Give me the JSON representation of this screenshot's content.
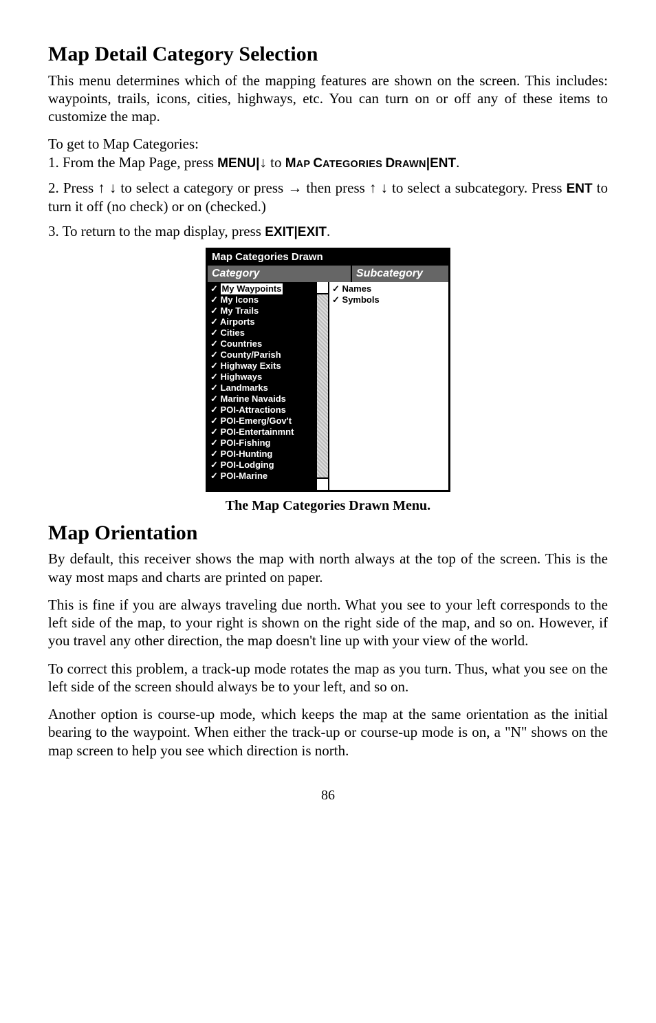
{
  "section1": {
    "heading": "Map Detail Category Selection",
    "p1": "This menu determines which of the mapping features are shown on the screen. This includes: waypoints, trails, icons, cities, highways, etc. You can turn on or off any of these items to customize the map.",
    "p2": "To get to Map Categories:",
    "step1_a": "1. From the Map Page, press ",
    "key_menu": "MENU",
    "step1_b": " to ",
    "smallcaps_m": "M",
    "smallcaps_ap": "AP ",
    "smallcaps_c": "C",
    "smallcaps_ategories": "ATEGORIES ",
    "smallcaps_d": "D",
    "smallcaps_rawn": "RAWN",
    "key_ent": "ENT",
    "step2_a": "2. Press ",
    "step2_b": " to select a category or press ",
    "step2_c": " then press ",
    "step2_d": " to select a subcategory. Press ",
    "step2_e": " to turn it off (no check) or on (checked.)",
    "step3_a": "3. To return to the map display, press ",
    "key_exit": "EXIT",
    "period": ".",
    "pipe": "|"
  },
  "figure": {
    "title": "Map Categories Drawn",
    "col_category": "Category",
    "col_subcategory": "Subcategory",
    "categories": [
      "My Waypoints",
      "My Icons",
      "My Trails",
      "Airports",
      "Cities",
      "Countries",
      "County/Parish",
      "Highway Exits",
      "Highways",
      "Landmarks",
      "Marine Navaids",
      "POI-Attractions",
      "POI-Emerg/Gov't",
      "POI-Entertainmnt",
      "POI-Fishing",
      "POI-Hunting",
      "POI-Lodging",
      "POI-Marine"
    ],
    "subcategories": [
      "Names",
      "Symbols"
    ],
    "caption": "The Map Categories Drawn Menu."
  },
  "section2": {
    "heading": "Map Orientation",
    "p1": "By default, this receiver shows the map with north always at the top of the screen. This is the way most maps and charts are printed on paper.",
    "p2": "This is fine if you are always traveling due north. What you see to your left corresponds to the left side of the map, to your right is shown on the right side of the map, and so on. However, if you travel any other direction, the map doesn't line up with your view of the world.",
    "p3": "To correct this problem, a track-up mode rotates the map as you turn. Thus, what you see on the left side of the screen should always be to your left, and so on.",
    "p4": "Another option is course-up mode, which keeps the map at the same orientation as the initial bearing to the waypoint. When either the track-up or course-up mode is on, a \"N\" shows on the map screen to help you see which direction is north."
  },
  "pagenum": "86"
}
